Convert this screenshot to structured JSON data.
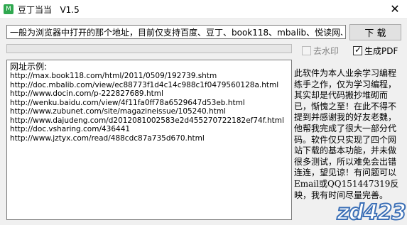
{
  "window": {
    "title": "豆丁当当   V1.5",
    "close_glyph": "✕",
    "app_icon_glyph": "M"
  },
  "toolbar": {
    "url_input_value": "一般为浏览器中打开的那个地址，目前仅支持百度、豆丁、book118、mbalib、悦读网、畅",
    "download_label": "下 载"
  },
  "progress": {
    "fraction": 0
  },
  "options": {
    "remove_watermark": {
      "label": "去水印",
      "checked": false,
      "enabled": false
    },
    "generate_pdf": {
      "label": "生成PDF",
      "checked": true,
      "enabled": true,
      "mark": "✓"
    }
  },
  "examples": {
    "heading": "网址示例:",
    "urls": [
      "http://max.book118.com/html/2011/0509/192739.shtm",
      "http://doc.mbalib.com/view/ec88773f1d4c14c988c1f0479560128a.html",
      "http://www.docin.com/p-222827689.html",
      "http://wenku.baidu.com/view/4f11fa0ff78a6529647d53eb.html",
      "http://www.zubunet.com/site/magazineissue/105240.html",
      "http://www.dajudeng.com/d2012081002583e2d455270722182ef74f.html",
      "http://doc.vsharing.com/436441",
      "http://www.jztyx.com/read/488cdc87a735d670.html"
    ]
  },
  "side_note": "此软件为本人业余学习编程练手之作，仅为学习编程，其实却是代码搬抄堆砌而已，惭愧之至！在此不得不提到并感谢我的好友老魏，他帮我完成了很大一部分代码。软件仅只实现了四个网站下载的基本功能，并未做很多测试，所以难免会出错连连，望见谅！有问题可以Email或QQ151447319反映，我有时间尽量完善。",
  "watermark": "zd423",
  "colors": {
    "progress_fill": "#06b025",
    "watermark_stroke": "#3b6fb6",
    "app_icon": "#2fa84f"
  }
}
